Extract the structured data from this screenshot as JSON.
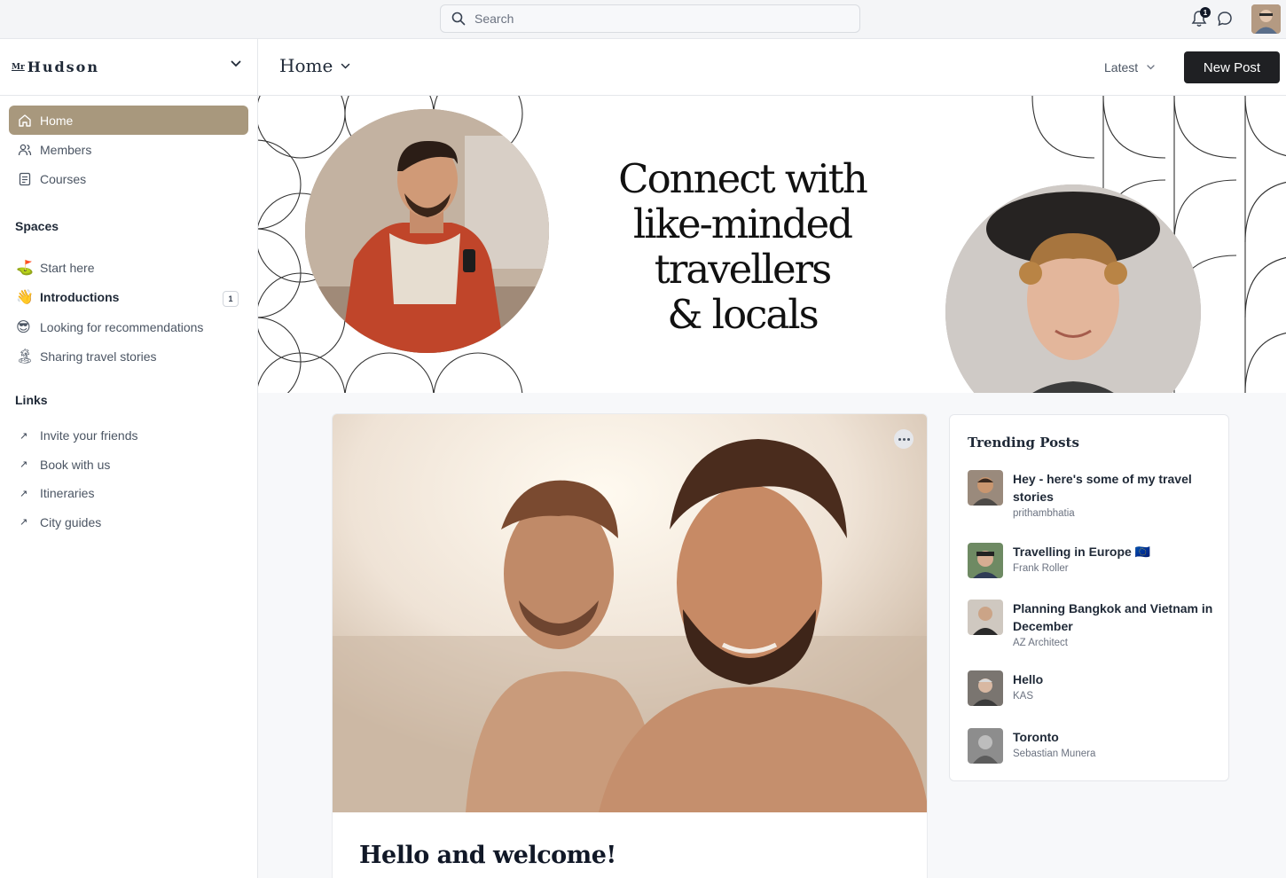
{
  "search": {
    "placeholder": "Search"
  },
  "notifications": {
    "count": "1"
  },
  "brand": {
    "prefix": "Mr",
    "name": "Hudson"
  },
  "sidebar": {
    "nav": [
      {
        "label": "Home",
        "icon": "home-icon",
        "active": true
      },
      {
        "label": "Members",
        "icon": "members-icon"
      },
      {
        "label": "Courses",
        "icon": "courses-icon"
      }
    ],
    "spaces_label": "Spaces",
    "spaces": [
      {
        "label": "Start here",
        "emoji": "⛳"
      },
      {
        "label": "Introductions",
        "emoji": "👋",
        "badge": "1"
      },
      {
        "label": "Looking for recommendations",
        "emoji": "😎"
      },
      {
        "label": "Sharing travel stories",
        "emoji": "🏝"
      }
    ],
    "links_label": "Links",
    "links": [
      {
        "label": "Invite your friends"
      },
      {
        "label": "Book with us"
      },
      {
        "label": "Itineraries"
      },
      {
        "label": "City guides"
      }
    ]
  },
  "header": {
    "title": "Home",
    "sort": "Latest",
    "new_post": "New Post"
  },
  "banner": {
    "headline_lines": [
      "Connect with",
      "like-minded",
      "travellers",
      "& locals"
    ]
  },
  "post": {
    "title": "Hello and welcome!"
  },
  "trending": {
    "title": "Trending Posts",
    "items": [
      {
        "title": "Hey - here's some of my travel stories",
        "author": "prithambhatia"
      },
      {
        "title": "Travelling in Europe 🇪🇺",
        "author": "Frank Roller"
      },
      {
        "title": "Planning Bangkok and Vietnam in December",
        "author": "AZ Architect"
      },
      {
        "title": "Hello",
        "author": "KAS"
      },
      {
        "title": "Toronto",
        "author": "Sebastian Munera"
      }
    ]
  },
  "colors": {
    "accent": "#a8987d",
    "button": "#1f2023"
  }
}
